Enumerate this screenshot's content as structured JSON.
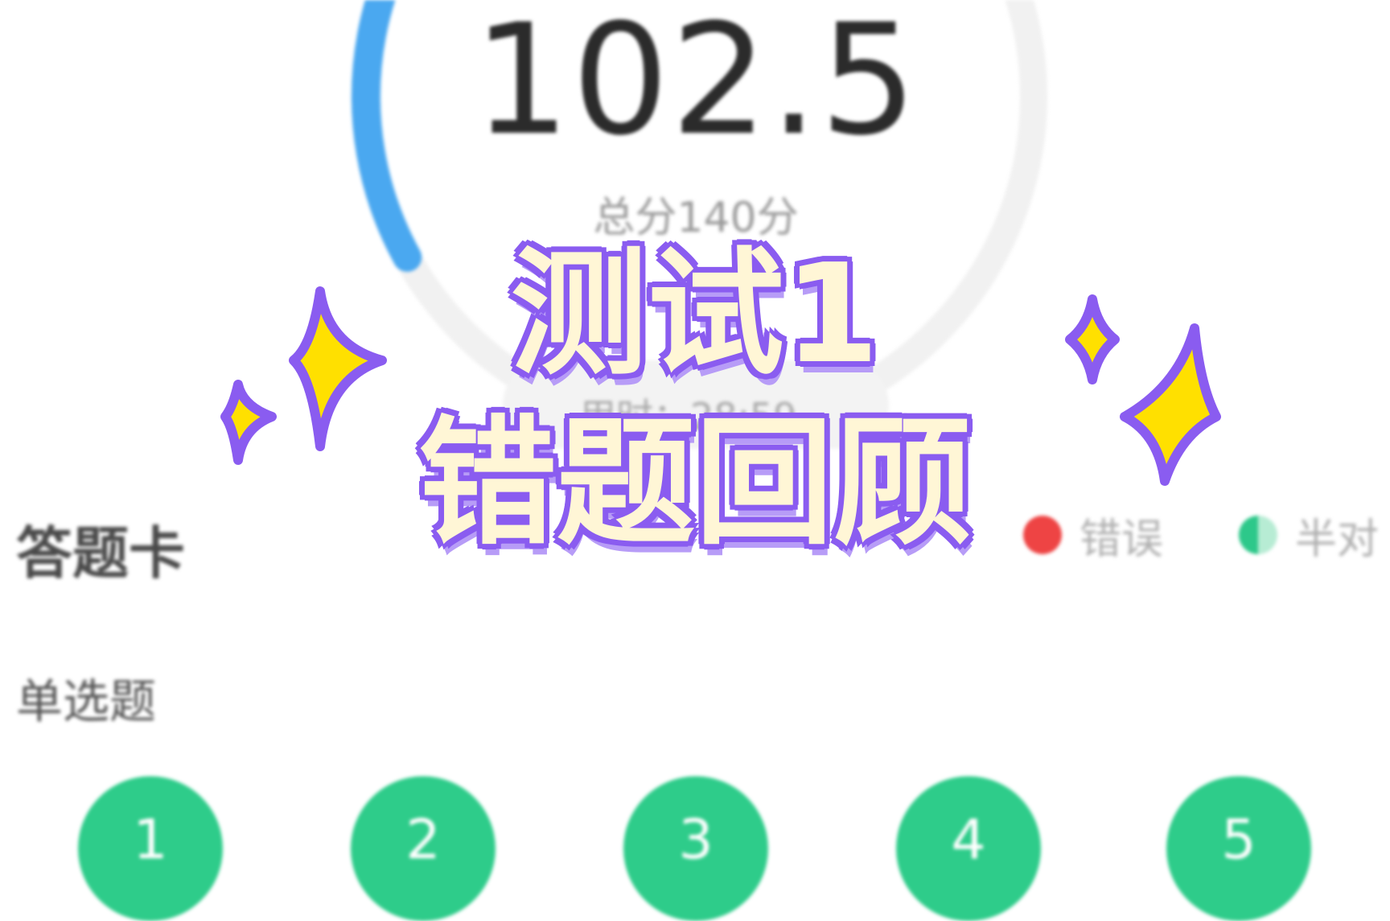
{
  "score": {
    "value": "102.5",
    "total": "总分140分",
    "time": "用时：28:59",
    "earned": 102.5,
    "max": 140
  },
  "answer_card": {
    "title": "答题卡",
    "legend": [
      {
        "label": "错误",
        "color": "#ee4444"
      },
      {
        "label": "半对",
        "color": "#2dc88a"
      }
    ]
  },
  "sections": [
    {
      "label": "单选题",
      "questions": [
        "1",
        "2",
        "3",
        "4",
        "5"
      ]
    }
  ],
  "overlay": {
    "line1": "测试1",
    "line2": "错题回顾"
  },
  "colors": {
    "gauge_progress": "#4aa8f0",
    "gauge_track": "#f1f1f1",
    "question_correct": "#2ecc8a",
    "overlay_text": "#fff6d6",
    "overlay_outline": "#8a5cf0",
    "sparkle_fill": "#ffe000"
  }
}
